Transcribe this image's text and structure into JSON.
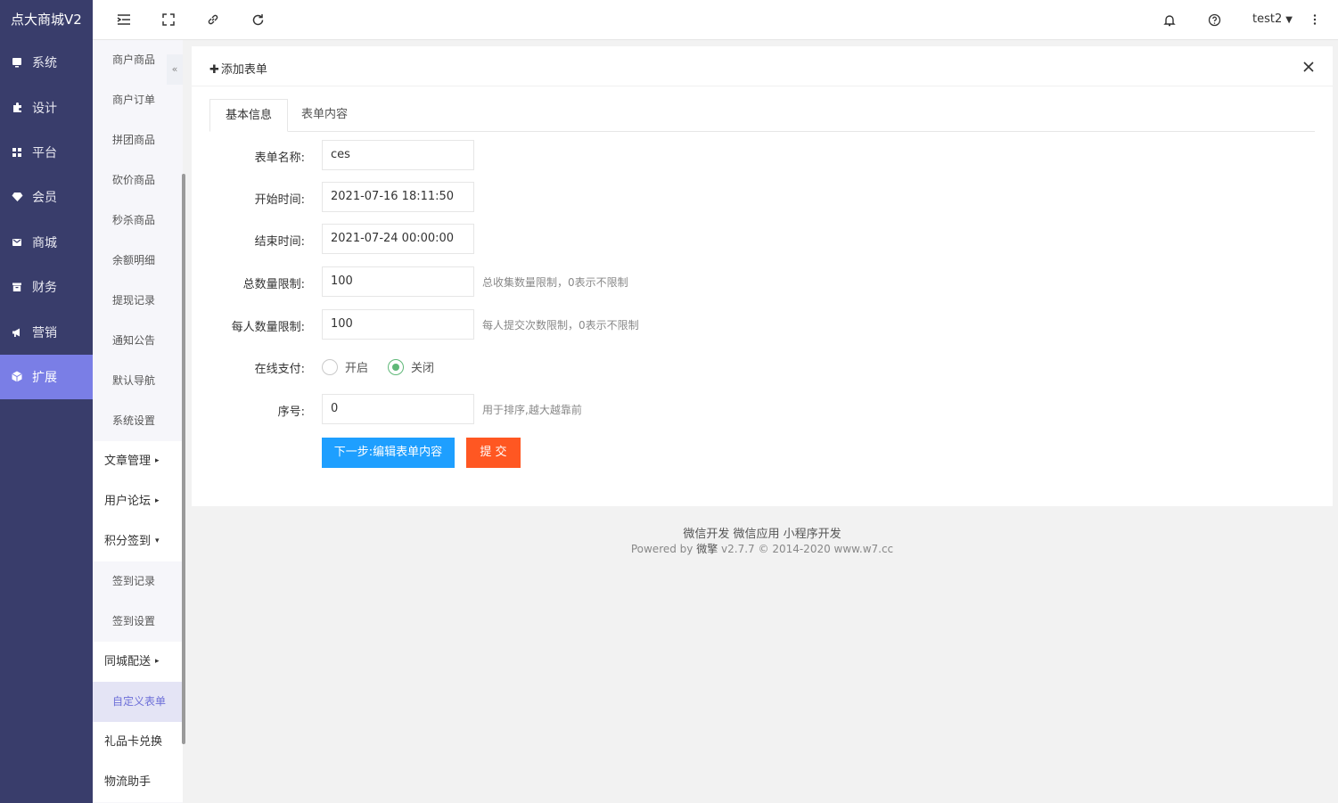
{
  "app": {
    "title": "点大商城V2"
  },
  "main_nav": [
    {
      "label": "系统",
      "icon": "monitor-icon"
    },
    {
      "label": "设计",
      "icon": "puzzle-icon"
    },
    {
      "label": "平台",
      "icon": "grid-icon"
    },
    {
      "label": "会员",
      "icon": "diamond-icon"
    },
    {
      "label": "商城",
      "icon": "mail-icon"
    },
    {
      "label": "财务",
      "icon": "archive-icon"
    },
    {
      "label": "营销",
      "icon": "megaphone-icon"
    },
    {
      "label": "扩展",
      "icon": "cube-icon",
      "active": true
    }
  ],
  "sub_nav": [
    {
      "label": "商户商品",
      "type": "item"
    },
    {
      "label": "商户订单",
      "type": "item"
    },
    {
      "label": "拼团商品",
      "type": "item"
    },
    {
      "label": "砍价商品",
      "type": "item"
    },
    {
      "label": "秒杀商品",
      "type": "item"
    },
    {
      "label": "余额明细",
      "type": "item"
    },
    {
      "label": "提现记录",
      "type": "item"
    },
    {
      "label": "通知公告",
      "type": "item"
    },
    {
      "label": "默认导航",
      "type": "item"
    },
    {
      "label": "系统设置",
      "type": "item"
    },
    {
      "label": "文章管理",
      "type": "group",
      "arrow": "▸"
    },
    {
      "label": "用户论坛",
      "type": "group",
      "arrow": "▸"
    },
    {
      "label": "积分签到",
      "type": "group",
      "arrow": "▾"
    },
    {
      "label": "签到记录",
      "type": "item"
    },
    {
      "label": "签到设置",
      "type": "item"
    },
    {
      "label": "同城配送",
      "type": "group",
      "arrow": "▸"
    },
    {
      "label": "自定义表单",
      "type": "item",
      "active": true
    },
    {
      "label": "礼品卡兑换",
      "type": "group",
      "arrow": ""
    },
    {
      "label": "物流助手",
      "type": "group",
      "arrow": ""
    }
  ],
  "topbar": {
    "user": "test2",
    "collapse_glyph": "«"
  },
  "card": {
    "title": "添加表单",
    "tabs": [
      "基本信息",
      "表单内容"
    ],
    "fields": {
      "name": {
        "label": "表单名称:",
        "value": "ces"
      },
      "start_time": {
        "label": "开始时间:",
        "value": "2021-07-16 18:11:50"
      },
      "end_time": {
        "label": "结束时间:",
        "value": "2021-07-24 00:00:00"
      },
      "total_limit": {
        "label": "总数量限制:",
        "value": "100",
        "hint": "总收集数量限制，0表示不限制"
      },
      "per_limit": {
        "label": "每人数量限制:",
        "value": "100",
        "hint": "每人提交次数限制，0表示不限制"
      },
      "online_pay": {
        "label": "在线支付:",
        "options": [
          "开启",
          "关闭"
        ],
        "selected": "关闭"
      },
      "sort": {
        "label": "序号:",
        "value": "0",
        "hint": "用于排序,越大越靠前"
      }
    },
    "buttons": {
      "next": "下一步:编辑表单内容",
      "submit": "提 交"
    }
  },
  "footer": {
    "line1": "微信开发 微信应用 小程序开发",
    "line2_prefix": "Powered by ",
    "line2_brand": "微擎",
    "line2_suffix": " v2.7.7 © 2014-2020 www.w7.cc"
  },
  "colors": {
    "sidebar": "#393d6b",
    "active_nav": "#7a7ee6",
    "primary_button": "#1e9fff",
    "submit_button": "#ff5722",
    "radio_checked": "#5fb878"
  }
}
